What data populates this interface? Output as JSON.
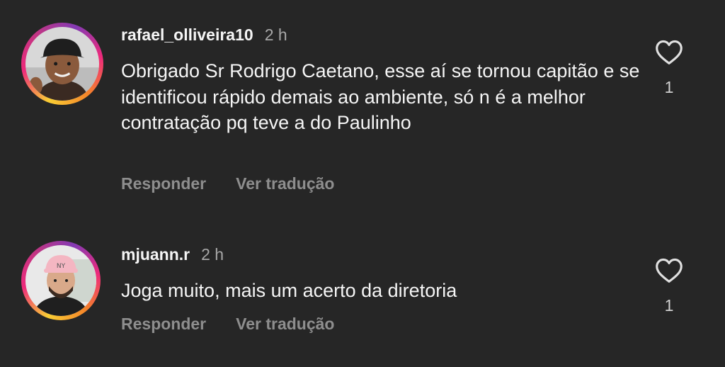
{
  "comments": [
    {
      "username": "rafael_olliveira10",
      "time": "2 h",
      "text": "Obrigado Sr Rodrigo Caetano, esse aí se tornou capitão e se identificou rápido demais ao ambiente, só n é a melhor contratação pq teve a do Paulinho",
      "reply_label": "Responder",
      "translate_label": "Ver tradução",
      "like_icon": "heart-icon",
      "like_count": "1"
    },
    {
      "username": "mjuann.r",
      "time": "2 h",
      "text": "Joga muito, mais um acerto da diretoria",
      "reply_label": "Responder",
      "translate_label": "Ver tradução",
      "like_icon": "heart-icon",
      "like_count": "1"
    }
  ],
  "colors": {
    "background": "#262626",
    "primary_text": "#f5f5f5",
    "secondary_text": "#a8a8a8",
    "action_text": "#8e8e8e",
    "story_ring": [
      "#f9ce34",
      "#ee2a7b",
      "#833ab4"
    ]
  }
}
